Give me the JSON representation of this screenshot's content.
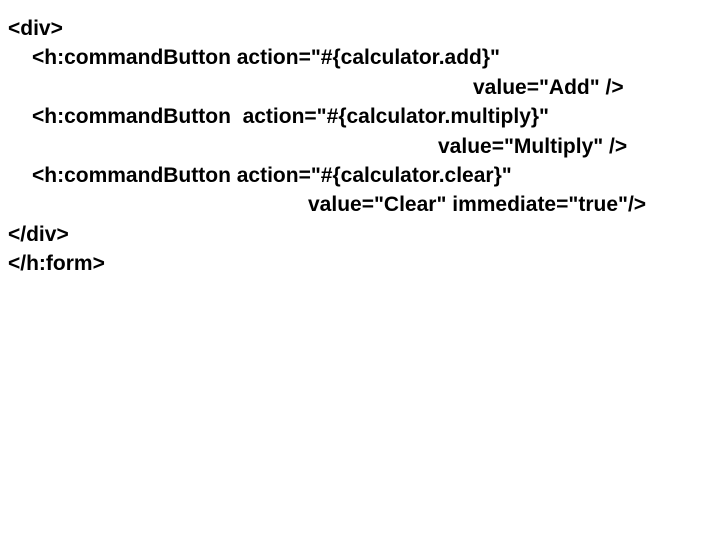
{
  "code": {
    "line1": "<div>",
    "line2": "<h:commandButton action=\"#{calculator.add}\"",
    "line3": "value=\"Add\" />",
    "line4": "<h:commandButton  action=\"#{calculator.multiply}\"",
    "line5": "value=\"Multiply\" />",
    "line6": "<h:commandButton action=\"#{calculator.clear}\"",
    "line7": "value=\"Clear\" immediate=\"true\"/>",
    "line8": "</div>",
    "line9": "</h:form>"
  }
}
